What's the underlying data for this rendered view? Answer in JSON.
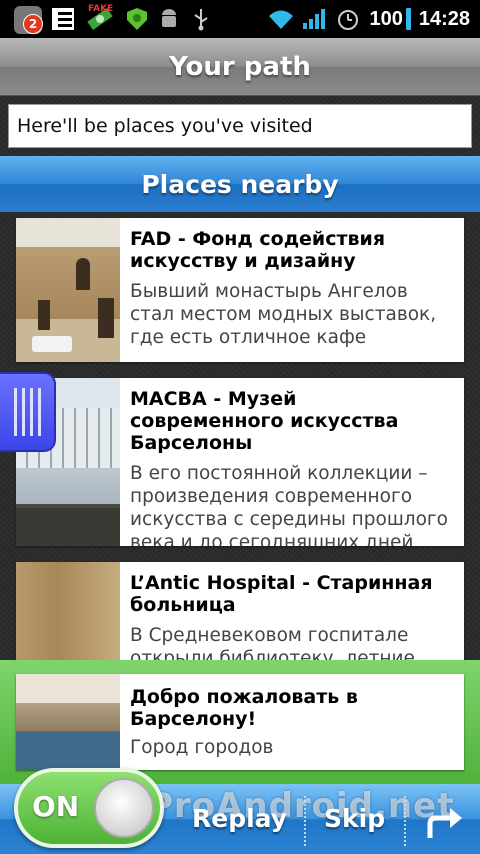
{
  "status_bar": {
    "notification_count": "2",
    "fake_label": "FAKE",
    "battery_percent": "100",
    "time": "14:28",
    "icons": [
      "app-icon",
      "list-icon",
      "fake-gps-icon",
      "shield-icon",
      "android-icon",
      "usb-icon",
      "wifi-icon",
      "signal-icon",
      "alarm-icon"
    ]
  },
  "header": {
    "title": "Your path"
  },
  "path": {
    "placeholder_text": "Here'll be places you've visited"
  },
  "nearby": {
    "title": "Places nearby",
    "places": [
      {
        "title": "FAD - Фонд содействия искусству и дизайну",
        "description": "Бывший монастырь Ангелов стал местом модных выставок, где есть отличное кафе"
      },
      {
        "title": "MACBA - Музей современного искусства Барселоны",
        "description": "В его постоянной коллекции – произведения современного искусства с середины прошлого века и до сегодняшних дней"
      },
      {
        "title": "L’Antic Hospital - Старинная больница",
        "description": "В Средневековом госпитале открыли библиотеку, летние"
      }
    ]
  },
  "welcome": {
    "title": "Добро пожаловать в Барселону!",
    "subtitle": "Город городов"
  },
  "bottom_bar": {
    "toggle_label": "ON",
    "replay_label": "Replay",
    "skip_label": "Skip",
    "watermark": "ProAndroid.net"
  },
  "colors": {
    "accent_blue": "#2f86d6",
    "toggle_green": "#4db235",
    "handle_blue": "#3b45e8"
  }
}
